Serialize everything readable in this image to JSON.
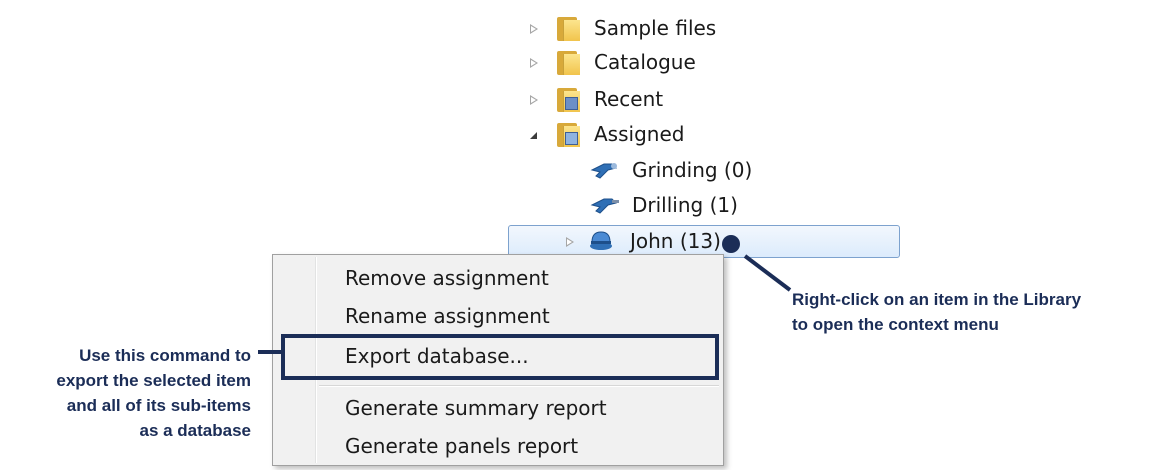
{
  "tree": {
    "items": [
      {
        "label": "Sample files",
        "icon": "folder-icon"
      },
      {
        "label": "Catalogue",
        "icon": "folder-icon"
      },
      {
        "label": "Recent",
        "icon": "recent-folder-icon"
      },
      {
        "label": "Assigned",
        "icon": "assigned-folder-icon"
      },
      {
        "label": "Grinding (0)",
        "icon": "grinder-tool-icon"
      },
      {
        "label": "Drilling (1)",
        "icon": "drill-tool-icon"
      },
      {
        "label": "John (13)",
        "icon": "person-icon",
        "selected": true
      }
    ]
  },
  "context_menu": {
    "items": [
      {
        "label": "Remove assignment"
      },
      {
        "label": "Rename assignment"
      },
      {
        "label": "Export database...",
        "highlighted": true
      },
      {
        "label": "Generate summary report"
      },
      {
        "label": "Generate panels report"
      }
    ]
  },
  "callouts": {
    "left": {
      "lines": [
        "Use this command to",
        "export the selected item",
        "and all of its sub-items",
        "as a database"
      ]
    },
    "right": {
      "lines": [
        "Right-click on an item in the Library",
        "to open the context menu"
      ]
    }
  },
  "colors": {
    "callout": "#1b2d57",
    "selection_border": "#7da2ce",
    "folder": "#f1c44c",
    "tool_blue": "#2f6fb5"
  }
}
